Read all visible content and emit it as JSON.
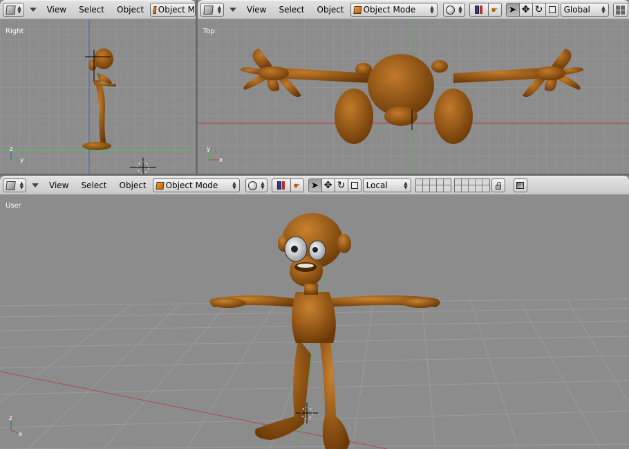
{
  "menus": {
    "view": "View",
    "select": "Select",
    "object": "Object"
  },
  "viewports": {
    "right": {
      "label": "Right",
      "mode": "Object M"
    },
    "top": {
      "label": "Top",
      "mode": "Object Mode",
      "orientation": "Global"
    },
    "user": {
      "label": "User",
      "mode": "Object Mode",
      "orientation": "Local"
    }
  },
  "axes": {
    "x": "x",
    "y": "y",
    "z": "z"
  },
  "colors": {
    "model": "#9a5510",
    "grid_bg": "#8c8c8c",
    "x_axis": "#b04040",
    "y_axis": "#40b040"
  }
}
